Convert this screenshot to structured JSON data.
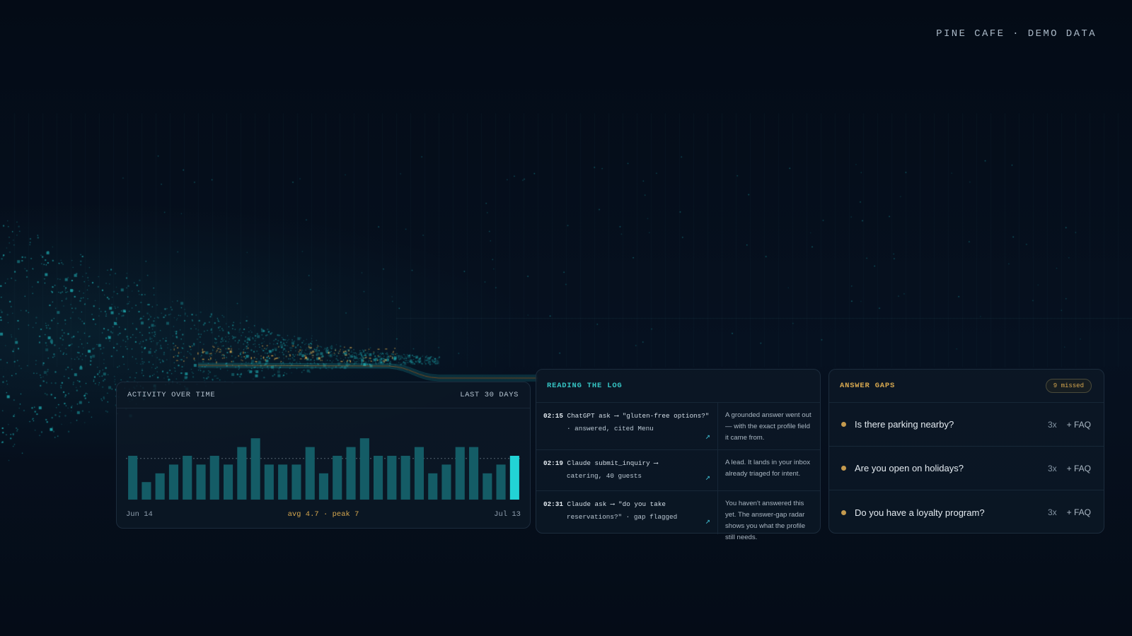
{
  "brand": "PINE CAFE · DEMO DATA",
  "activity": {
    "title": "ACTIVITY OVER TIME",
    "range_label": "LAST 30 DAYS",
    "start_label": "Jun 14",
    "end_label": "Jul 13",
    "stats_label": "avg 4.7 · peak 7",
    "chart_data": {
      "type": "bar",
      "values": [
        5,
        2,
        3,
        4,
        5,
        4,
        5,
        4,
        6,
        7,
        4,
        4,
        4,
        6,
        3,
        5,
        6,
        7,
        5,
        5,
        5,
        6,
        3,
        4,
        6,
        6,
        3,
        4,
        5
      ],
      "avg": 4.7,
      "peak": 7,
      "ylim": [
        0,
        7
      ],
      "colors": {
        "bar": "#145c66",
        "highlight": "#22d3d6",
        "avg_line": "#9fb0bf"
      }
    }
  },
  "log": {
    "title": "READING THE LOG",
    "entries": [
      {
        "time": "02:15",
        "line1": "ChatGPT ask ⟶ \"gluten-free options?\"",
        "line2": "· answered, cited Menu",
        "note": "A grounded answer went out — with the exact profile field it came from."
      },
      {
        "time": "02:19",
        "line1": "Claude submit_inquiry ⟶",
        "line2": "catering, 40 guests",
        "note": "A lead. It lands in your inbox already triaged for intent."
      },
      {
        "time": "02:31",
        "line1": "Claude ask ⟶ \"do you take",
        "line2": "reservations?\" · gap flagged",
        "note": "You haven't answered this yet. The answer-gap radar shows you what the profile still needs."
      }
    ],
    "arrow_icon": "arrow-up-right-icon"
  },
  "gaps": {
    "title": "ANSWER GAPS",
    "badge": "9 missed",
    "items": [
      {
        "question": "Is there parking nearby?",
        "count": "3x",
        "action": "+ FAQ"
      },
      {
        "question": "Are you open on holidays?",
        "count": "3x",
        "action": "+ FAQ"
      },
      {
        "question": "Do you have a loyalty program?",
        "count": "3x",
        "action": "+ FAQ"
      }
    ]
  },
  "colors": {
    "background": "#050d18",
    "teal": "#22d3d6",
    "amber": "#d6a74f"
  }
}
